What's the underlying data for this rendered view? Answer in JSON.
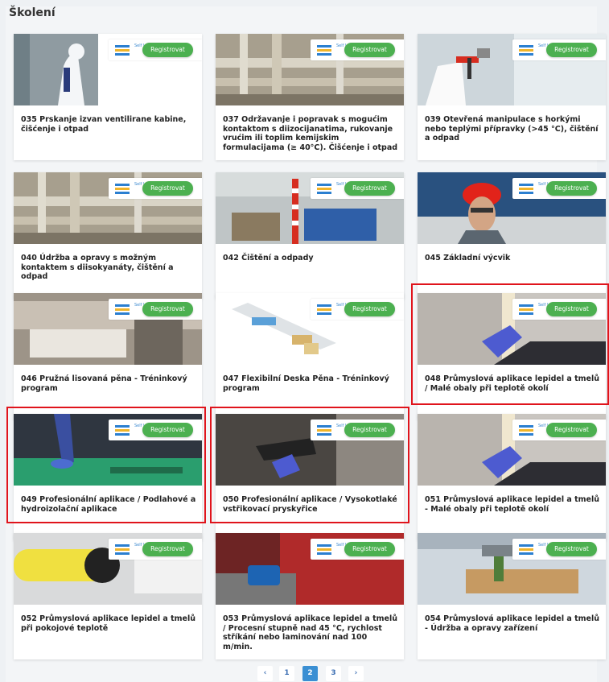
{
  "page": {
    "heading": "Školení"
  },
  "badge": {
    "logo_text": "Self Learning"
  },
  "register_label": "Registrovat",
  "courses": [
    {
      "title": "035 Prskanje izvan ventilirane kabine, čišćenje i otpad",
      "image": "ppe-sprayer"
    },
    {
      "title": "037 Održavanje i popravak s mogućim kontaktom s diizocijanatima, rukovanje vrućim ili toplim kemijskim formulacijama (≥ 40°C). Čišćenje i otpad",
      "image": "industrial-pipes"
    },
    {
      "title": "039 Otevřená manipulace s horkými nebo teplými přípravky (>45 °C), čištění a odpad",
      "image": "spray-gun"
    },
    {
      "title": "040 Údržba a opravy s možným kontaktem s diisokyanáty, čištění a odpad",
      "image": "industrial-pipes"
    },
    {
      "title": "042 Čištění a odpady",
      "image": "warehouse-drums"
    },
    {
      "title": "045 Základní výcvik",
      "image": "worker-helmet"
    },
    {
      "title": "046 Pružná lisovaná pěna - Tréninkový program",
      "image": "foam-molding"
    },
    {
      "title": "047 Flexibilní Deska Pěna - Tréninkový program",
      "image": "foam-line"
    },
    {
      "title": "048 Průmyslová aplikace lepidel a tmelů / Malé obaly při teplotě okolí",
      "image": "sealant-glove"
    },
    {
      "title": "049 Profesionální aplikace / Podlahové a hydroizolační aplikace",
      "image": "floor-coating"
    },
    {
      "title": "050 Profesionální aplikace / Vysokotlaké vstřikovací pryskyřice",
      "image": "injection-gun"
    },
    {
      "title": "051 Průmyslová aplikace lepidel a tmelů - Malé obaly při teplotě okolí",
      "image": "sealant-glove"
    },
    {
      "title": "052 Průmyslová aplikace lepidel a tmelů při pokojové teplotě",
      "image": "cartridge-gun"
    },
    {
      "title": "053 Průmyslová aplikace lepidel a tmelů / Procesní stupně nad 45 °C, rychlost stříkání nebo laminování nad 100 m/min.",
      "image": "laminating-machine"
    },
    {
      "title": "054 Průmyslová aplikace lepidel a tmelů - Údržba a opravy zařízení",
      "image": "robot-dispenser"
    }
  ],
  "pagination": {
    "prev": "‹",
    "pages": [
      "1",
      "2",
      "3"
    ],
    "active": "2",
    "next": "›"
  },
  "colors": {
    "accent": "#3a8fd3",
    "register": "#4cb050",
    "highlight": "#e0141c"
  }
}
